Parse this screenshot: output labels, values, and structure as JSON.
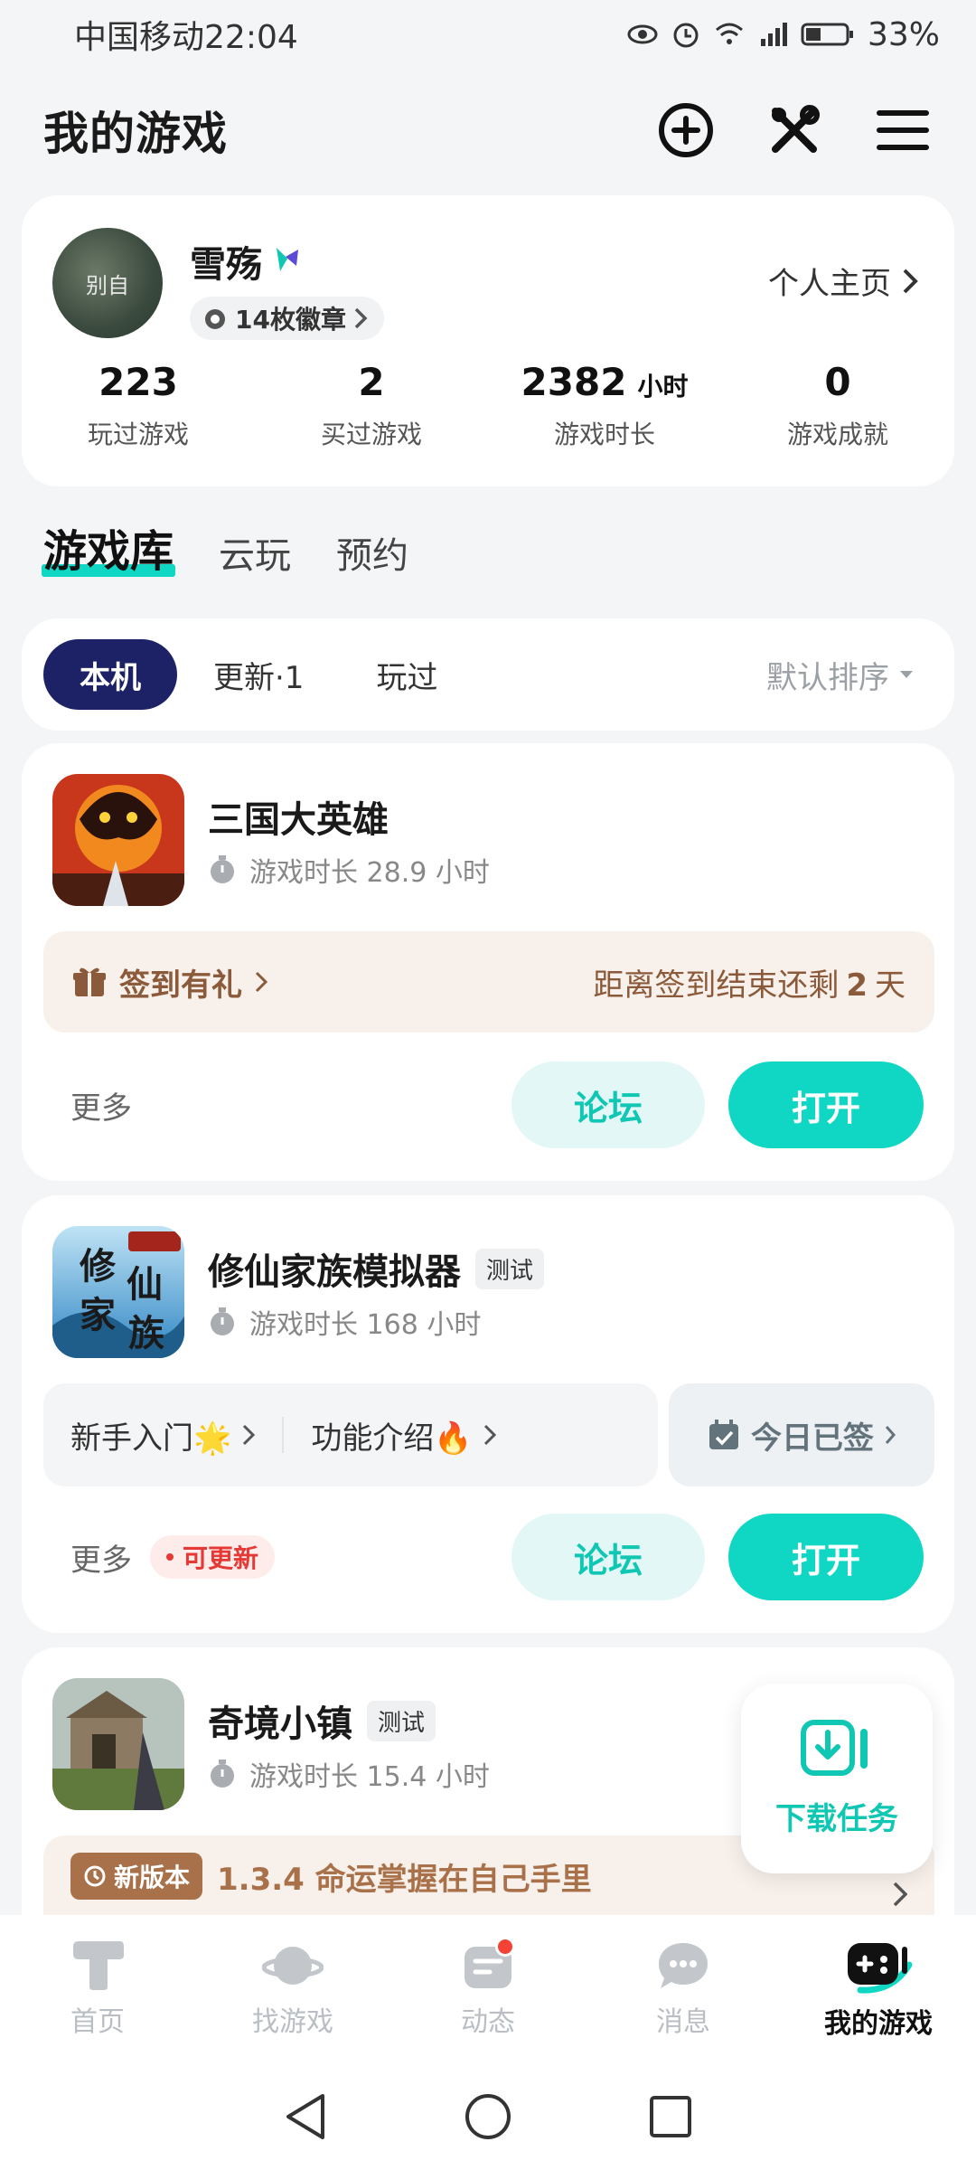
{
  "status_bar": {
    "carrier": "中国移动",
    "time": "22:04",
    "battery": "33%"
  },
  "header": {
    "title": "我的游戏",
    "icons": [
      "add-circle-icon",
      "tools-icon",
      "menu-icon"
    ]
  },
  "profile": {
    "avatar_text": "别自",
    "name": "雪殇",
    "badges": "14枚徽章",
    "homepage_link": "个人主页",
    "stats": [
      {
        "value": "223",
        "unit": "",
        "label": "玩过游戏"
      },
      {
        "value": "2",
        "unit": "",
        "label": "买过游戏"
      },
      {
        "value": "2382",
        "unit": "小时",
        "label": "游戏时长"
      },
      {
        "value": "0",
        "unit": "",
        "label": "游戏成就"
      }
    ]
  },
  "main_tabs": [
    "游戏库",
    "云玩",
    "预约"
  ],
  "filters": {
    "chips": [
      "本机",
      "更新·1",
      "玩过"
    ],
    "sort": "默认排序"
  },
  "games": [
    {
      "title": "三国大英雄",
      "playtime": "游戏时长 28.9 小时",
      "signin": {
        "label": "签到有礼",
        "countdown_prefix": "距离签到结束还剩",
        "days": "2",
        "days_suffix": "天"
      },
      "more": "更多",
      "forum": "论坛",
      "open": "打开"
    },
    {
      "title": "修仙家族模拟器",
      "tag": "测试",
      "playtime": "游戏时长 168 小时",
      "guide": {
        "beginner": "新手入门🌟",
        "features": "功能介绍🔥",
        "checkin": "今日已签"
      },
      "more": "更多",
      "update": "可更新",
      "forum": "论坛",
      "open": "打开"
    },
    {
      "title": "奇境小镇",
      "tag": "测试",
      "playtime": "游戏时长 15.4 小时",
      "new_version": {
        "badge": "新版本",
        "text": "1.3.4 命运掌握在自己手里"
      }
    }
  ],
  "fab": {
    "label": "下载任务"
  },
  "bottom_nav": [
    {
      "label": "首页",
      "icon": "home-icon"
    },
    {
      "label": "找游戏",
      "icon": "planet-icon"
    },
    {
      "label": "动态",
      "icon": "feed-icon"
    },
    {
      "label": "消息",
      "icon": "message-icon"
    },
    {
      "label": "我的游戏",
      "icon": "gamepad-icon"
    }
  ],
  "colors": {
    "accent": "#10d7c3",
    "navy": "#1d2166",
    "brown": "#8a5a3a"
  }
}
